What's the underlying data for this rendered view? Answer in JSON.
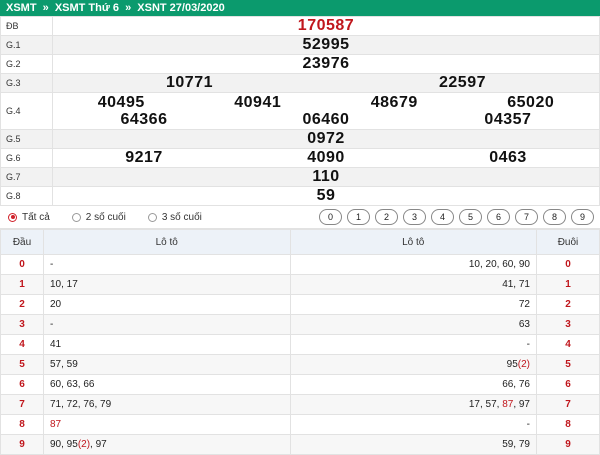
{
  "breadcrumb": [
    "XSMT",
    "»",
    "XSMT Thứ 6",
    "»",
    "XSNT 27/03/2020"
  ],
  "results": {
    "db": {
      "label": "ĐB",
      "numbers": [
        "170587"
      ]
    },
    "g1": {
      "label": "G.1",
      "numbers": [
        "52995"
      ]
    },
    "g2": {
      "label": "G.2",
      "numbers": [
        "23976"
      ]
    },
    "g3": {
      "label": "G.3",
      "numbers": [
        "10771",
        "22597"
      ]
    },
    "g4": {
      "label": "G.4",
      "numbers": [
        "40495",
        "40941",
        "48679",
        "65020",
        "64366",
        "06460",
        "04357"
      ]
    },
    "g5": {
      "label": "G.5",
      "numbers": [
        "0972"
      ]
    },
    "g6": {
      "label": "G.6",
      "numbers": [
        "9217",
        "4090",
        "0463"
      ]
    },
    "g7": {
      "label": "G.7",
      "numbers": [
        "110"
      ]
    },
    "g8": {
      "label": "G.8",
      "numbers": [
        "59"
      ]
    }
  },
  "filters": {
    "options": [
      "Tất cả",
      "2 số cuối",
      "3 số cuối"
    ],
    "selected": "Tất cả",
    "digits": [
      "0",
      "1",
      "2",
      "3",
      "4",
      "5",
      "6",
      "7",
      "8",
      "9"
    ]
  },
  "loto": {
    "headers": [
      "Đầu",
      "Lô tô",
      "Lô tô",
      "Đuôi"
    ],
    "rows": [
      {
        "dau": "0",
        "left": "-",
        "right": "10, 20, 60, 90",
        "duoi": "0"
      },
      {
        "dau": "1",
        "left": "10, 17",
        "right": "41, 71",
        "duoi": "1"
      },
      {
        "dau": "2",
        "left": "20",
        "right": "72",
        "duoi": "2"
      },
      {
        "dau": "3",
        "left": "-",
        "right": "63",
        "duoi": "3"
      },
      {
        "dau": "4",
        "left": "41",
        "right": "-",
        "duoi": "4"
      },
      {
        "dau": "5",
        "left": "57, 59",
        "right": "95(2)",
        "duoi": "5"
      },
      {
        "dau": "6",
        "left": "60, 63, 66",
        "right": "66, 76",
        "duoi": "6"
      },
      {
        "dau": "7",
        "left": "71, 72, 76, 79",
        "right": "17, 57, 87, 97",
        "duoi": "7"
      },
      {
        "dau": "8",
        "left": "87",
        "right": "-",
        "duoi": "8"
      },
      {
        "dau": "9",
        "left": "90, 95(2), 97",
        "right": "59, 79",
        "duoi": "9"
      }
    ]
  },
  "colors": {
    "header_green": "#0b9a6d",
    "special_red": "#c0161c"
  }
}
